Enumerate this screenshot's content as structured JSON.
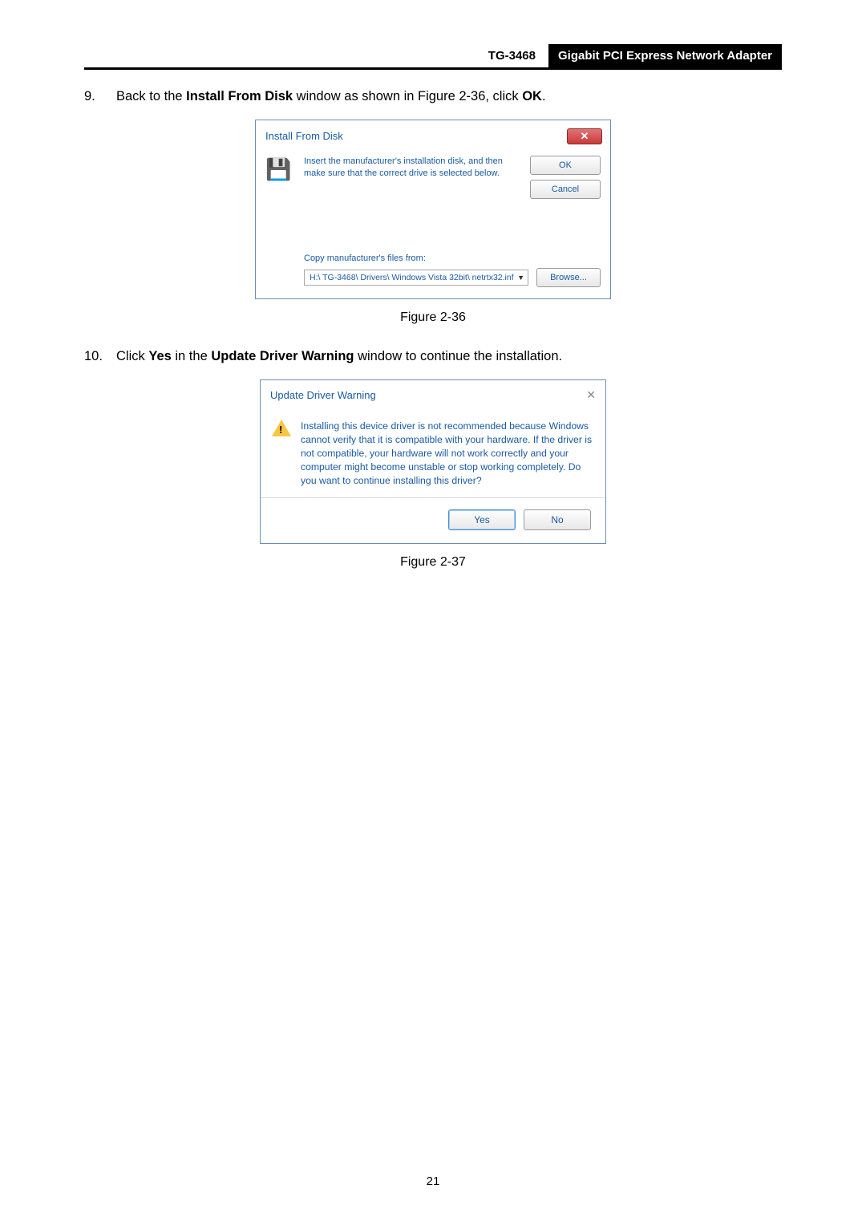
{
  "header": {
    "model": "TG-3468",
    "product": "Gigabit PCI Express Network Adapter"
  },
  "steps": {
    "s9num": "9.",
    "s9": {
      "pre": "Back to the ",
      "b1": "Install From Disk",
      "mid": " window as shown in Figure 2-36, click ",
      "b2": "OK",
      "post": "."
    },
    "s10num": "10.",
    "s10": {
      "pre": "Click ",
      "b1": "Yes",
      "mid": " in the ",
      "b2": "Update Driver Warning",
      "post": " window to continue the installation."
    }
  },
  "dlg1": {
    "title": "Install From Disk",
    "instr": "Insert the manufacturer's installation disk, and then make sure that the correct drive is selected below.",
    "ok": "OK",
    "cancel": "Cancel",
    "copy_label": "Copy manufacturer's files from:",
    "path": "H:\\ TG-3468\\ Drivers\\ Windows Vista 32bit\\ netrtx32.inf",
    "browse": "Browse..."
  },
  "caption1": "Figure 2-36",
  "dlg2": {
    "title": "Update Driver Warning",
    "msg": "Installing this device driver is not recommended because Windows cannot verify that it is compatible with your hardware. If the driver is not compatible, your hardware will not work correctly and your computer might become unstable or stop working completely.  Do you want to continue installing this driver?",
    "yes": "Yes",
    "no": "No"
  },
  "caption2": "Figure 2-37",
  "page_number": "21"
}
